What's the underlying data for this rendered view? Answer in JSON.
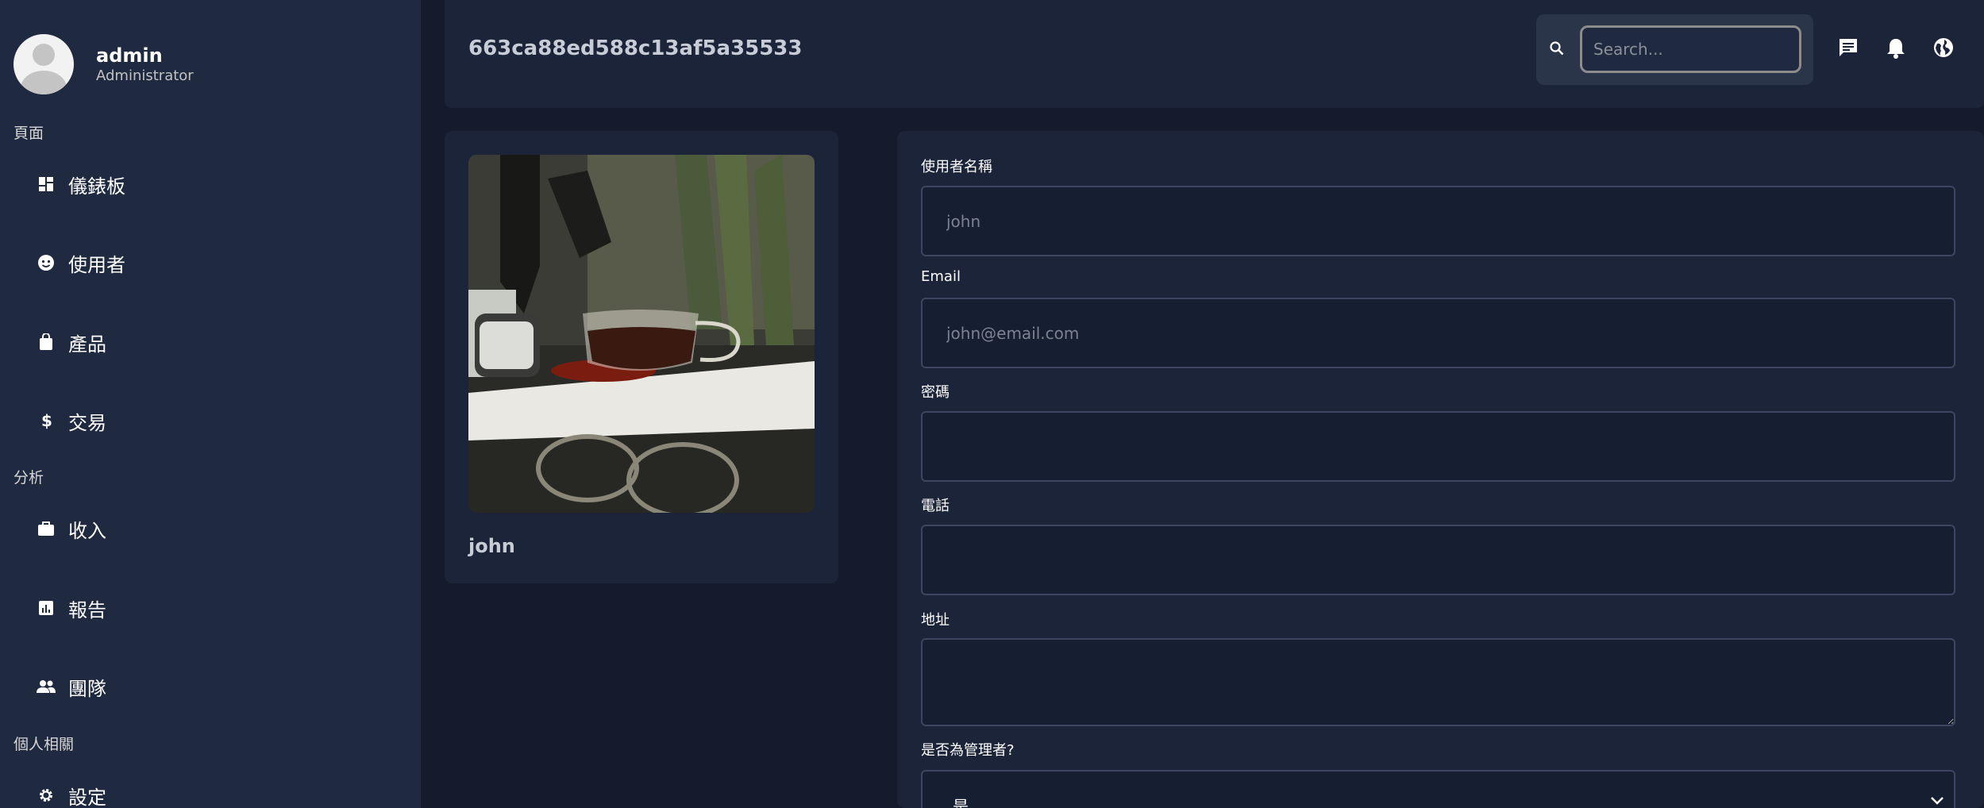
{
  "sidebar": {
    "user": {
      "name": "admin",
      "role": "Administrator"
    },
    "sections": [
      {
        "title": "頁面"
      },
      {
        "title": "分析"
      },
      {
        "title": "個人相關"
      }
    ],
    "items": [
      {
        "label": "儀錶板",
        "icon": "dashboard-icon"
      },
      {
        "label": "使用者",
        "icon": "face-icon"
      },
      {
        "label": "產品",
        "icon": "shopping-bag-icon"
      },
      {
        "label": "交易",
        "icon": "dollar-icon"
      },
      {
        "label": "收入",
        "icon": "briefcase-icon"
      },
      {
        "label": "報告",
        "icon": "report-chart-icon"
      },
      {
        "label": "團隊",
        "icon": "people-icon"
      },
      {
        "label": "設定",
        "icon": "gear-icon"
      }
    ]
  },
  "header": {
    "title": "663ca88ed588c13af5a35533",
    "search_placeholder": "Search...",
    "icons": [
      "chat-icon",
      "bell-icon",
      "globe-icon"
    ]
  },
  "profile_card": {
    "name": "john"
  },
  "form": {
    "username_label": "使用者名稱",
    "username_placeholder": "john",
    "email_label": "Email",
    "email_placeholder": "john@email.com",
    "password_label": "密碼",
    "phone_label": "電話",
    "address_label": "地址",
    "admin_label": "是否為管理者?",
    "admin_value": "是"
  }
}
